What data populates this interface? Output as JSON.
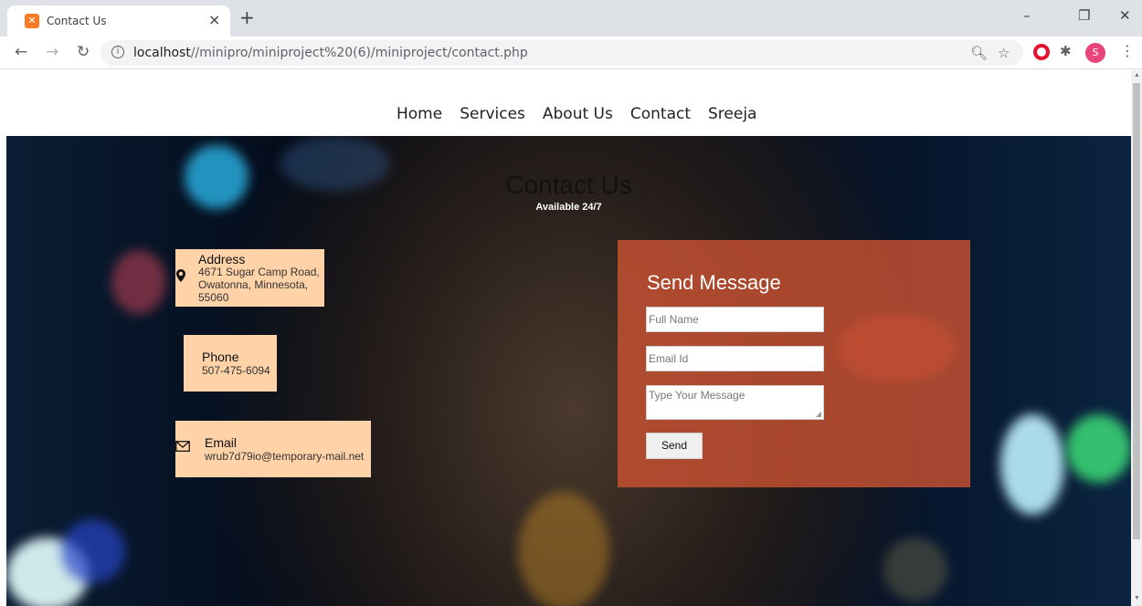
{
  "browser": {
    "tab_title": "Contact Us",
    "tab_close": "×",
    "new_tab": "+",
    "url_host": "localhost",
    "url_path": "//minipro/miniproject%20(6)/miniproject/contact.php",
    "avatar_letter": "S",
    "icons": [
      "xampp-favicon",
      "back-icon",
      "forward-icon",
      "reload-icon",
      "info-icon",
      "zoom-icon",
      "star-icon",
      "opera-icon",
      "puzzle-icon",
      "menu-icon",
      "minimize-icon",
      "restore-icon",
      "close-icon"
    ]
  },
  "nav": {
    "items": [
      "Home",
      "Services",
      "About Us",
      "Contact",
      "Sreeja"
    ]
  },
  "hero": {
    "title": "Contact Us",
    "subtitle": "Available 24/7"
  },
  "contact": {
    "address": {
      "label": "Address",
      "line1": "4671 Sugar Camp Road,",
      "line2": "Owatonna, Minnesota,",
      "line3": "55060"
    },
    "phone": {
      "label": "Phone",
      "value": "507-475-6094"
    },
    "email": {
      "label": "Email",
      "value": "wrub7d79io@temporary-mail.net"
    }
  },
  "form": {
    "title": "Send Message",
    "name_placeholder": "Full Name",
    "email_placeholder": "Email Id",
    "message_placeholder": "Type Your Message",
    "send_label": "Send"
  },
  "colors": {
    "form_panel": "#c85232",
    "info_box": "#ffd2a8"
  }
}
